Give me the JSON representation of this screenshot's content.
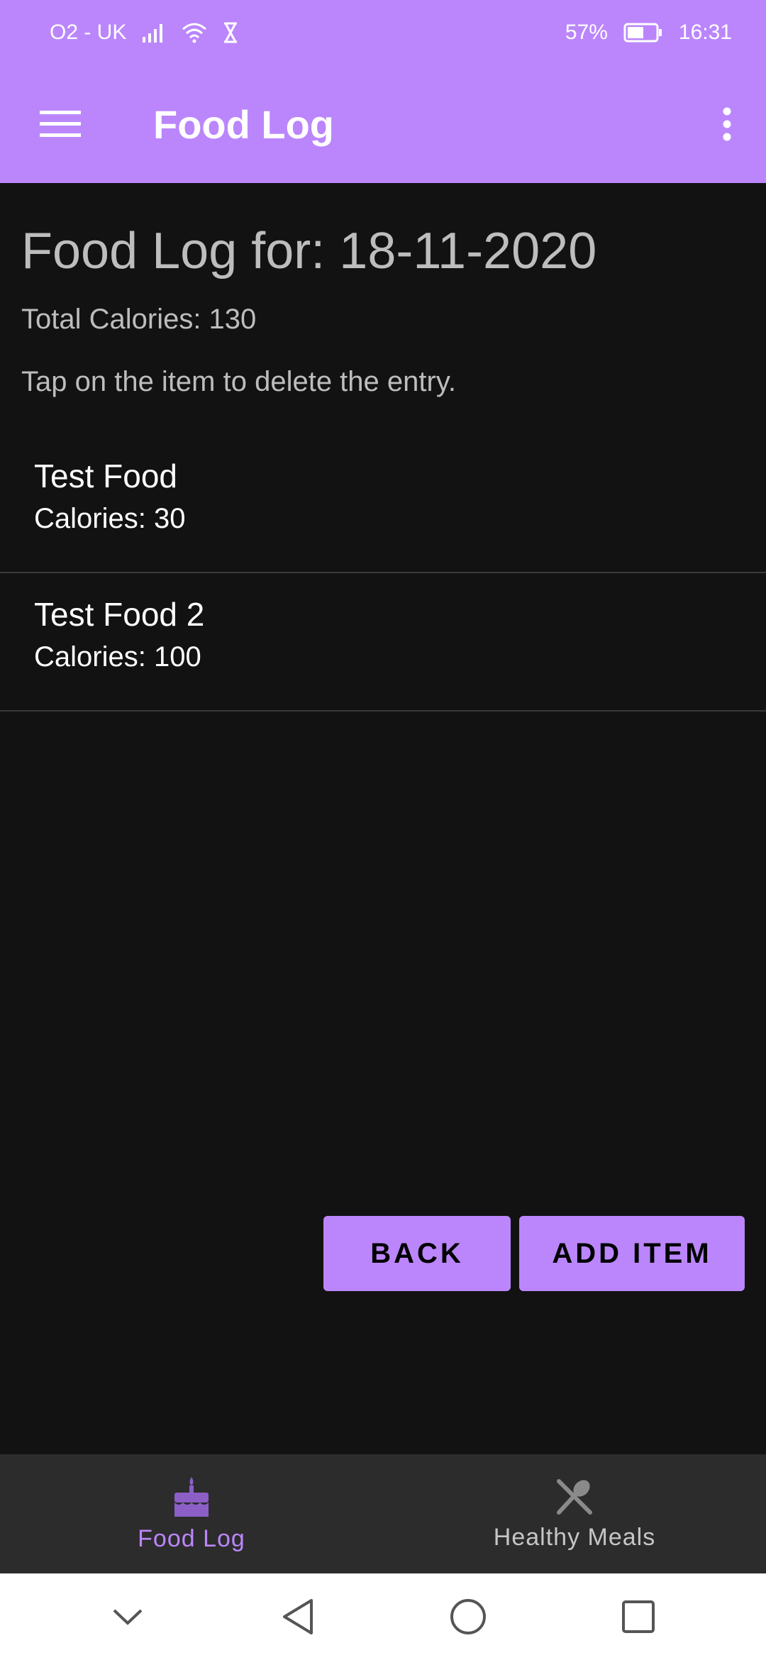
{
  "status_bar": {
    "carrier": "O2 - UK",
    "battery": "57%",
    "time": "16:31"
  },
  "app_bar": {
    "title": "Food Log",
    "menu_icon": "hamburger-menu-icon",
    "more_icon": "more-vert-icon"
  },
  "page": {
    "log_title": "Food Log for: 18-11-2020",
    "total_calories": "Total Calories: 130",
    "hint": "Tap on the item to delete the entry."
  },
  "entries": [
    {
      "name": "Test Food",
      "calories": "Calories: 30"
    },
    {
      "name": "Test Food 2",
      "calories": "Calories: 100"
    }
  ],
  "buttons": {
    "back": "BACK",
    "add_item": "ADD ITEM"
  },
  "bottom_nav": {
    "tabs": [
      {
        "label": "Food Log",
        "icon": "cake-icon",
        "active": true
      },
      {
        "label": "Healthy Meals",
        "icon": "restaurant-icon",
        "active": false
      }
    ]
  },
  "colors": {
    "accent": "#bb86fc",
    "background": "#121212",
    "nav_background": "#2c2c2c"
  }
}
